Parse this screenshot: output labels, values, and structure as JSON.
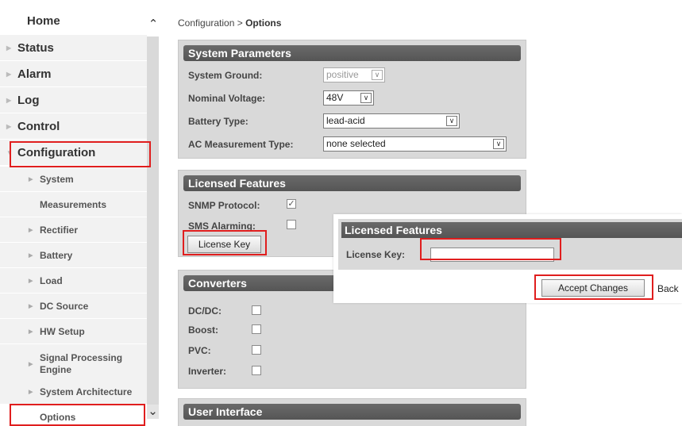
{
  "sidebar": {
    "home": "Home",
    "top_items": [
      "Status",
      "Alarm",
      "Log",
      "Control",
      "Configuration"
    ],
    "sub_items": [
      "System",
      "Measurements",
      "Rectifier",
      "Battery",
      "Load",
      "DC Source",
      "HW Setup",
      "Signal Processing Engine",
      "System Architecture",
      "Options"
    ],
    "scroll_up_icon": "chevron-up-icon",
    "scroll_down_icon": "chevron-down-icon"
  },
  "breadcrumb": {
    "parent": "Configuration",
    "separator": ">",
    "current": "Options"
  },
  "system_parameters": {
    "title": "System Parameters",
    "system_ground_label": "System Ground:",
    "system_ground_value": "positive",
    "nominal_voltage_label": "Nominal Voltage:",
    "nominal_voltage_value": "48V",
    "battery_type_label": "Battery Type:",
    "battery_type_value": "lead-acid",
    "ac_measurement_label": "AC Measurement Type:",
    "ac_measurement_value": "none selected"
  },
  "licensed_features": {
    "title": "Licensed Features",
    "snmp_label": "SNMP Protocol:",
    "snmp_checked": true,
    "sms_label": "SMS Alarming:",
    "sms_checked": false,
    "license_key_button": "License Key"
  },
  "converters": {
    "title": "Converters",
    "dcdc_label": "DC/DC:",
    "boost_label": "Boost:",
    "pvc_label": "PVC:",
    "inverter_label": "Inverter:"
  },
  "user_interface": {
    "title": "User Interface"
  },
  "popup": {
    "title": "Licensed Features",
    "license_key_label": "License Key:",
    "license_key_value": "",
    "accept_button": "Accept Changes",
    "back_link": "Back"
  },
  "colors": {
    "highlight": "#e01e1e",
    "panel_header": "#5f5f5f",
    "panel_bg": "#d9d9d9"
  }
}
